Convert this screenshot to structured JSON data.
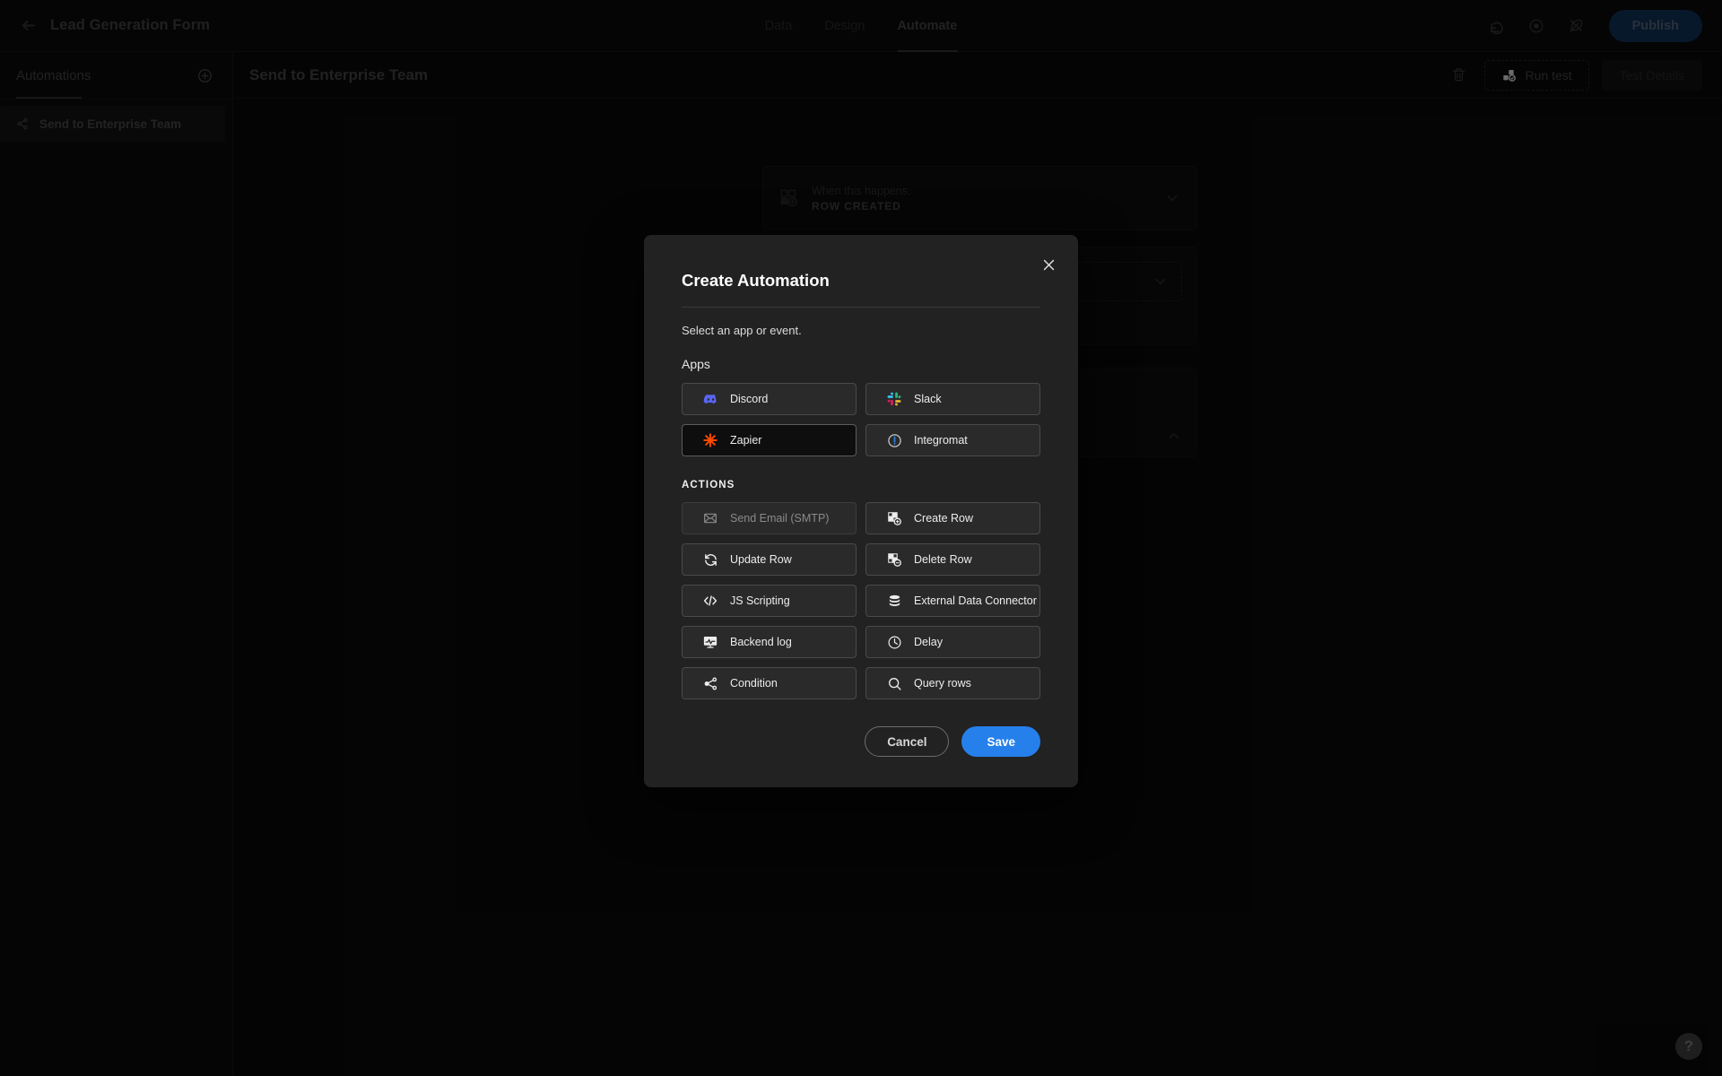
{
  "topbar": {
    "back_icon": "arrow-left-icon",
    "app_title": "Lead Generation Form",
    "tabs": [
      {
        "label": "Data",
        "active": false
      },
      {
        "label": "Design",
        "active": false
      },
      {
        "label": "Automate",
        "active": true
      }
    ],
    "undo_icon": "undo-icon",
    "preview_icon": "eye-preview-icon",
    "theme_icon": "feather-slash-icon",
    "publish_label": "Publish",
    "publish_color": "#10355e"
  },
  "sidebar": {
    "title": "Automations",
    "add_icon": "plus-circle-icon",
    "items": [
      {
        "label": "Send to Enterprise Team",
        "icon": "share-nodes-icon",
        "selected": true
      }
    ]
  },
  "content": {
    "title": "Send to Enterprise Team",
    "delete_icon": "trash-icon",
    "run_test_label": "Run test",
    "run_test_icon": "run-test-icon",
    "test_details_label": "Test Details",
    "test_details_disabled": true
  },
  "canvas": {
    "trigger": {
      "icon": "row-created-icon",
      "when_label": "When this happens:",
      "event_label": "ROW CREATED",
      "chevron": "chevron-down-icon"
    },
    "filter_card": {
      "chevron": "chevron-down-icon"
    },
    "lower_card": {
      "chevron": "chevron-up-icon"
    }
  },
  "modal": {
    "title": "Create Automation",
    "close_icon": "close-icon",
    "subtitle": "Select an app or event.",
    "apps_label": "Apps",
    "apps": [
      {
        "label": "Discord",
        "icon": "discord-icon",
        "state": "normal"
      },
      {
        "label": "Slack",
        "icon": "slack-icon",
        "state": "normal"
      },
      {
        "label": "Zapier",
        "icon": "zapier-icon",
        "state": "hovered"
      },
      {
        "label": "Integromat",
        "icon": "integromat-icon",
        "state": "normal"
      }
    ],
    "actions_label": "ACTIONS",
    "actions": [
      {
        "label": "Send Email (SMTP)",
        "icon": "envelope-icon",
        "state": "disabled"
      },
      {
        "label": "Create Row",
        "icon": "create-row-icon",
        "state": "normal"
      },
      {
        "label": "Update Row",
        "icon": "refresh-icon",
        "state": "normal"
      },
      {
        "label": "Delete Row",
        "icon": "delete-row-icon",
        "state": "normal"
      },
      {
        "label": "JS Scripting",
        "icon": "code-icon",
        "state": "normal"
      },
      {
        "label": "External Data Connector",
        "icon": "database-icon",
        "state": "normal"
      },
      {
        "label": "Backend log",
        "icon": "backend-log-icon",
        "state": "normal"
      },
      {
        "label": "Delay",
        "icon": "clock-icon",
        "state": "normal"
      },
      {
        "label": "Condition",
        "icon": "share-nodes-icon",
        "state": "normal"
      },
      {
        "label": "Query rows",
        "icon": "search-icon",
        "state": "normal"
      }
    ],
    "cancel_label": "Cancel",
    "save_label": "Save",
    "save_color": "#2680eb"
  },
  "help": {
    "label": "?"
  }
}
